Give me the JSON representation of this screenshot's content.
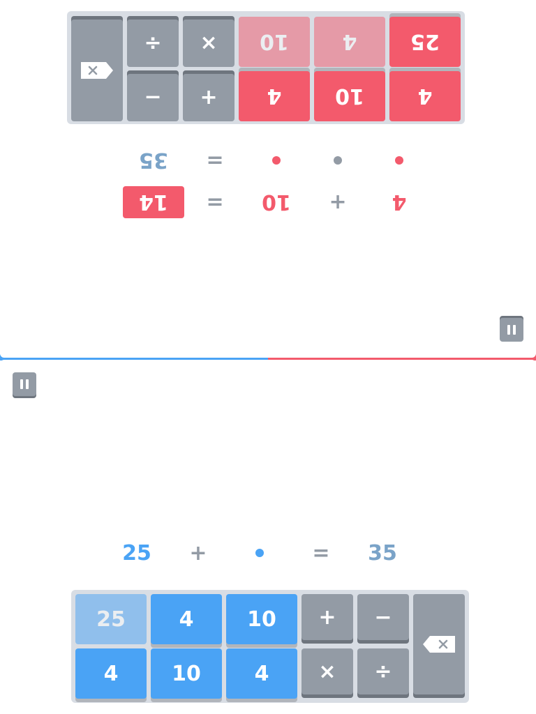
{
  "colors": {
    "blue": "#4aa3f5",
    "red": "#f35a6c",
    "gray": "#939ba5",
    "target": "#7aa3c8"
  },
  "progress": {
    "blue_fraction": 0.5,
    "red_fraction": 0.5
  },
  "player_red": {
    "pause_icon": "pause-icon",
    "prior_equation": {
      "a": "4",
      "op": "+",
      "b": "10",
      "eq": "=",
      "result": "14"
    },
    "current_equation": {
      "a_slot": "•",
      "op_slot": "•",
      "b_slot": "•",
      "eq": "=",
      "target": "35"
    },
    "numbers": [
      "4",
      "10",
      "4",
      "25",
      "4",
      "10"
    ],
    "numbers_used": [
      false,
      false,
      false,
      false,
      true,
      true
    ],
    "ops": {
      "divide": "÷",
      "multiply": "×",
      "minus": "−",
      "plus": "+"
    },
    "backspace_icon": "backspace-icon"
  },
  "player_blue": {
    "pause_icon": "pause-icon",
    "current_equation": {
      "a": "25",
      "op": "+",
      "b_slot": "•",
      "eq": "=",
      "target": "35"
    },
    "numbers": [
      "25",
      "4",
      "10",
      "4",
      "10",
      "4"
    ],
    "numbers_used": [
      true,
      false,
      false,
      false,
      false,
      false
    ],
    "ops": {
      "plus": "+",
      "minus": "−",
      "multiply": "×",
      "divide": "÷"
    },
    "backspace_icon": "backspace-icon"
  }
}
